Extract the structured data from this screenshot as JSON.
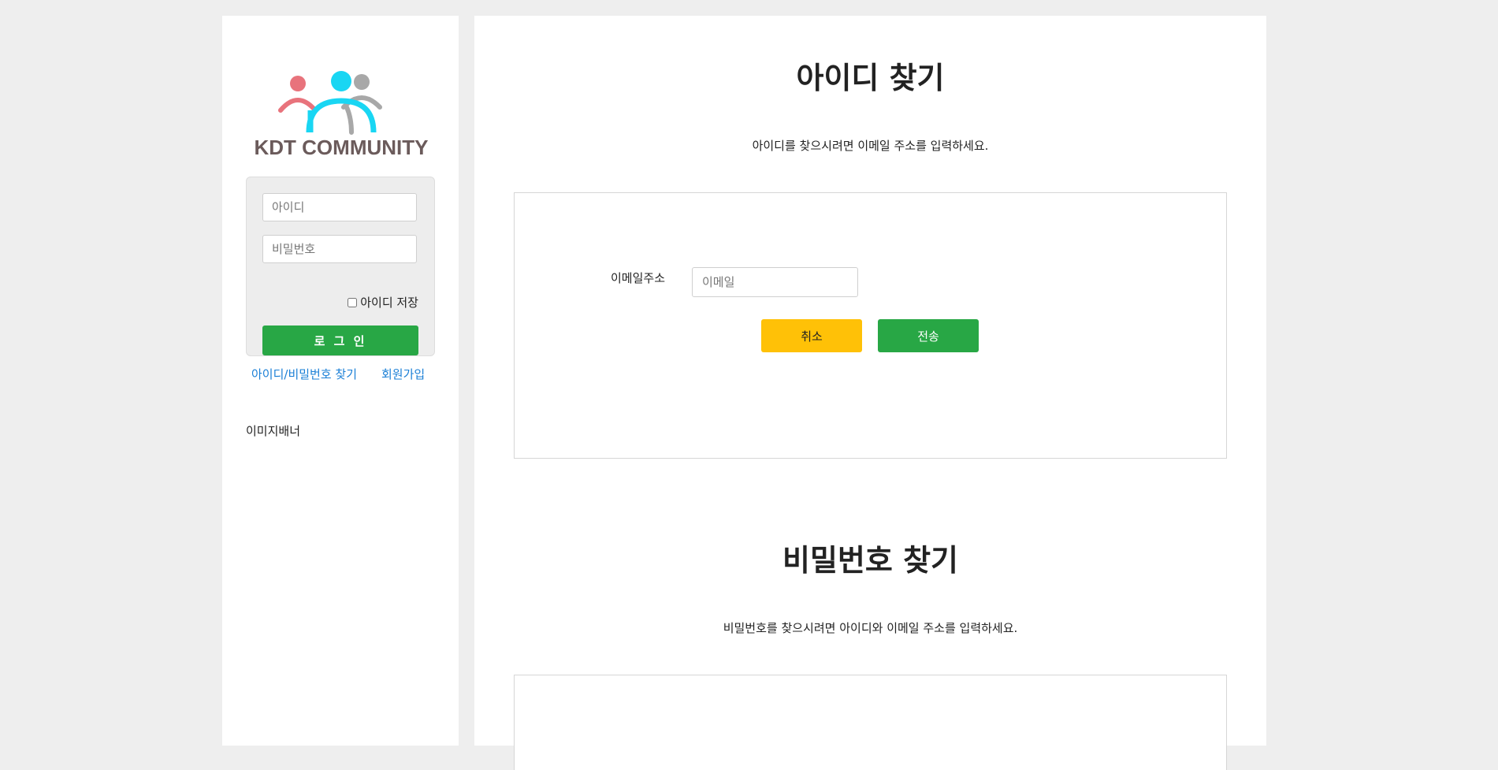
{
  "brand": {
    "name": "KDT COMMUNITY"
  },
  "login": {
    "id_placeholder": "아이디",
    "pw_placeholder": "비밀번호",
    "remember_label": "아이디 저장",
    "login_button": "로 그 인"
  },
  "links": {
    "find_account": "아이디/비밀번호 찾기",
    "signup": "회원가입"
  },
  "banner": {
    "label": "이미지배너"
  },
  "find_id": {
    "title": "아이디 찾기",
    "description": "아이디를 찾으시려면 이메일 주소를 입력하세요.",
    "email_label": "이메일주소",
    "email_placeholder": "이메일",
    "cancel_button": "취소",
    "submit_button": "전송"
  },
  "find_pw": {
    "title": "비밀번호 찾기",
    "description": "비밀번호를 찾으시려면 아이디와 이메일 주소를 입력하세요."
  },
  "colors": {
    "primary": "#28a745",
    "warning": "#ffc107",
    "link": "#1a7fd6",
    "logo_red": "#e8737c",
    "logo_cyan": "#19d6f3",
    "logo_gray": "#a8a8a8",
    "logo_text": "#6b5b5b"
  }
}
